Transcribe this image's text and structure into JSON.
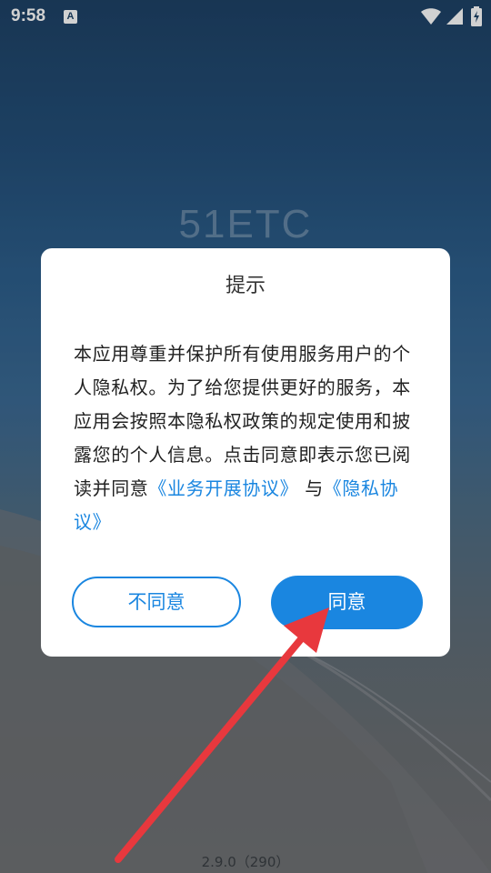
{
  "status_bar": {
    "time": "9:58",
    "notification_icon": "a-keyboard-icon",
    "wifi_icon": "wifi-icon",
    "signal_icon": "cellular-signal-icon",
    "battery_icon": "battery-charging-icon"
  },
  "splash": {
    "logo": "51ETC",
    "version": "2.9.0（290）"
  },
  "dialog": {
    "title": "提示",
    "body_text": "本应用尊重并保护所有使用服务用户的个人隐私权。为了给您提供更好的服务，本应用会按照本隐私权政策的规定使用和披露您的个人信息。点击同意即表示您已阅读并同意",
    "link_business": "《业务开展协议》",
    "connector": "与",
    "link_privacy": "《隐私协议》",
    "disagree_label": "不同意",
    "agree_label": "同意"
  },
  "colors": {
    "accent": "#1a86e0",
    "annotation_arrow": "#e8383d"
  }
}
